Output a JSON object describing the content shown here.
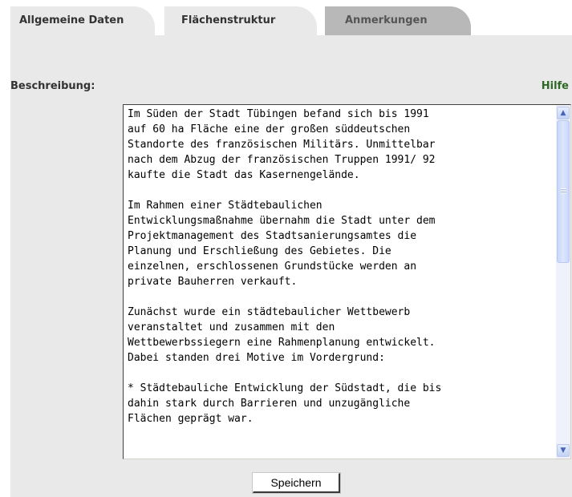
{
  "tabs": [
    {
      "label": "Allgemeine Daten",
      "active": true
    },
    {
      "label": "Flächenstruktur",
      "active": false
    },
    {
      "label": "Anmerkungen",
      "active": false
    }
  ],
  "form": {
    "description_label": "Beschreibung:",
    "help_label": "Hilfe",
    "save_label": "Speichern"
  },
  "description": {
    "lines": [
      "Im Süden der Stadt Tübingen befand sich bis 1991",
      "auf 60 ha Fläche eine der großen süddeutschen",
      "Standorte des französischen Militärs. Unmittelbar",
      "nach dem Abzug der französischen Truppen 1991/ 92",
      "kaufte die Stadt das Kasernengelände.",
      "",
      "Im Rahmen einer Städtebaulichen",
      "Entwicklungsmaßnahme übernahm die Stadt unter dem",
      "Projektmanagement des Stadtsanierungsamtes die",
      "Planung und Erschließung des Gebietes. Die",
      "einzelnen, erschlossenen Grundstücke werden an",
      "private Bauherren verkauft.",
      "",
      "Zunächst wurde ein städtebaulicher Wettbewerb",
      "veranstaltet und zusammen mit den",
      "Wettbewerbssiegern eine Rahmenplanung entwickelt.",
      "Dabei standen drei Motive im Vordergrund:",
      "",
      "* Städtebauliche Entwicklung der Südstadt, die bis",
      "dahin stark durch Barrieren und unzugängliche",
      "Flächen geprägt war."
    ]
  },
  "colors": {
    "panel_bg": "#e9e9e9",
    "inactive_tab_bg": "#b8b8b8",
    "help_link": "#2e6a26",
    "scrollbar": "#c8d6fb"
  },
  "icons": {
    "scroll_up": "chevron-up-icon",
    "scroll_down": "chevron-down-icon"
  }
}
